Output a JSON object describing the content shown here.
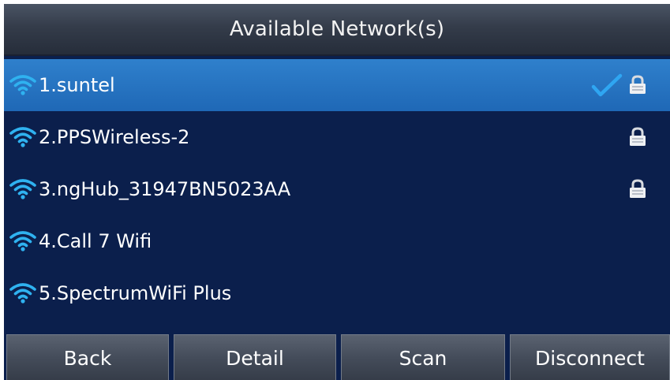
{
  "title": "Available Network(s)",
  "networks": [
    {
      "label": "1.suntel",
      "secured": true,
      "connected": true,
      "selected": true
    },
    {
      "label": "2.PPSWireless-2",
      "secured": true,
      "connected": false,
      "selected": false
    },
    {
      "label": "3.ngHub_31947BN5023AA",
      "secured": true,
      "connected": false,
      "selected": false
    },
    {
      "label": "4.Call 7 Wifi",
      "secured": false,
      "connected": false,
      "selected": false
    },
    {
      "label": "5.SpectrumWiFi Plus",
      "secured": false,
      "connected": false,
      "selected": false
    }
  ],
  "softkeys": {
    "back": "Back",
    "detail": "Detail",
    "scan": "Scan",
    "disconnect": "Disconnect"
  },
  "icons": {
    "wifi": "wifi-icon",
    "check": "checkmark-icon",
    "lock": "lock-icon"
  },
  "colors": {
    "background": "#0b1f4c",
    "selected_row": "#2a78c6",
    "wifi_icon": "#2fb2f0",
    "checkmark": "#2fa6f2",
    "text": "#ffffff"
  }
}
